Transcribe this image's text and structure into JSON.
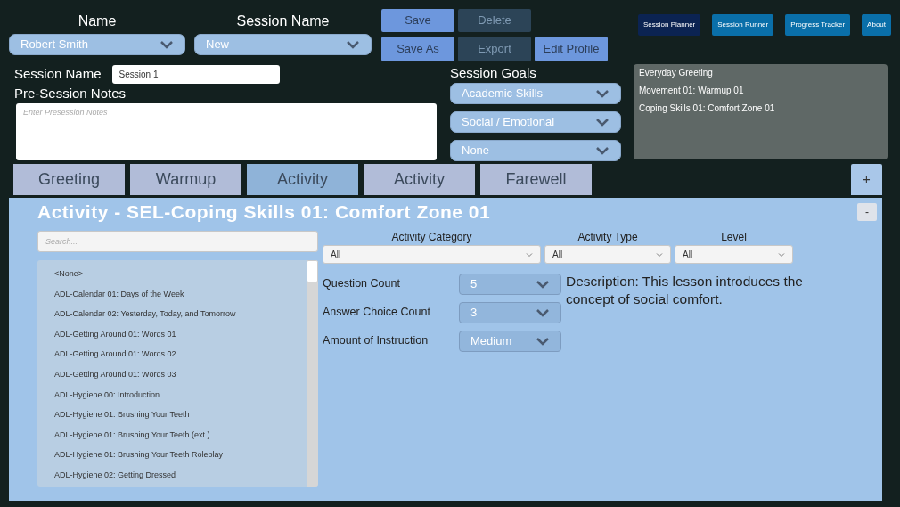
{
  "header": {
    "name_label": "Name",
    "name_value": "Robert Smith",
    "session_label": "Session Name",
    "session_value": "New"
  },
  "actions": [
    {
      "label": "Save",
      "disabled": false
    },
    {
      "label": "Delete",
      "disabled": true
    },
    {
      "label": "Save As",
      "disabled": false
    },
    {
      "label": "Export",
      "disabled": true
    },
    {
      "label": "Edit Profile",
      "disabled": false
    }
  ],
  "nav": [
    {
      "label": "Session Planner",
      "selected": true
    },
    {
      "label": "Session Runner",
      "selected": false
    },
    {
      "label": "Progress Tracker",
      "selected": false
    },
    {
      "label": "About",
      "selected": false
    }
  ],
  "session": {
    "name_label": "Session Name",
    "name_value": "Session 1",
    "notes_label": "Pre-Session Notes",
    "notes_placeholder": "Enter Presession Notes"
  },
  "goals": {
    "label": "Session Goals",
    "options": [
      "Academic Skills",
      "Social / Emotional",
      "None"
    ]
  },
  "plan_summary": [
    "Everyday Greeting",
    "Movement 01: Warmup 01",
    "Coping Skills 01: Comfort Zone 01"
  ],
  "tabs": [
    {
      "label": "Greeting",
      "selected": false
    },
    {
      "label": "Warmup",
      "selected": false
    },
    {
      "label": "Activity",
      "selected": true
    },
    {
      "label": "Activity",
      "selected": false
    },
    {
      "label": "Farewell",
      "selected": false
    }
  ],
  "add_tab": "+",
  "panel": {
    "title": "Activity - SEL-Coping Skills 01: Comfort Zone 01",
    "collapse": "-",
    "search_placeholder": "Search...",
    "activities": [
      "<None>",
      "ADL-Calendar 01: Days of the Week",
      "ADL-Calendar 02: Yesterday, Today, and Tomorrow",
      "ADL-Getting Around 01: Words 01",
      "ADL-Getting Around 01: Words 02",
      "ADL-Getting Around 01: Words 03",
      "ADL-Hygiene 00: Introduction",
      "ADL-Hygiene 01: Brushing Your Teeth",
      "ADL-Hygiene 01: Brushing Your Teeth (ext.)",
      "ADL-Hygiene 01: Brushing Your Teeth Roleplay",
      "ADL-Hygiene 02: Getting Dressed"
    ],
    "filters": [
      {
        "label": "Activity Category",
        "value": "All"
      },
      {
        "label": "Activity Type",
        "value": "All"
      },
      {
        "label": "Level",
        "value": "All"
      }
    ],
    "settings": [
      {
        "label": "Question Count",
        "value": "5"
      },
      {
        "label": "Answer Choice Count",
        "value": "3"
      },
      {
        "label": "Amount of Instruction",
        "value": "Medium"
      }
    ],
    "description": "Description: This lesson introduces the concept of social comfort."
  }
}
